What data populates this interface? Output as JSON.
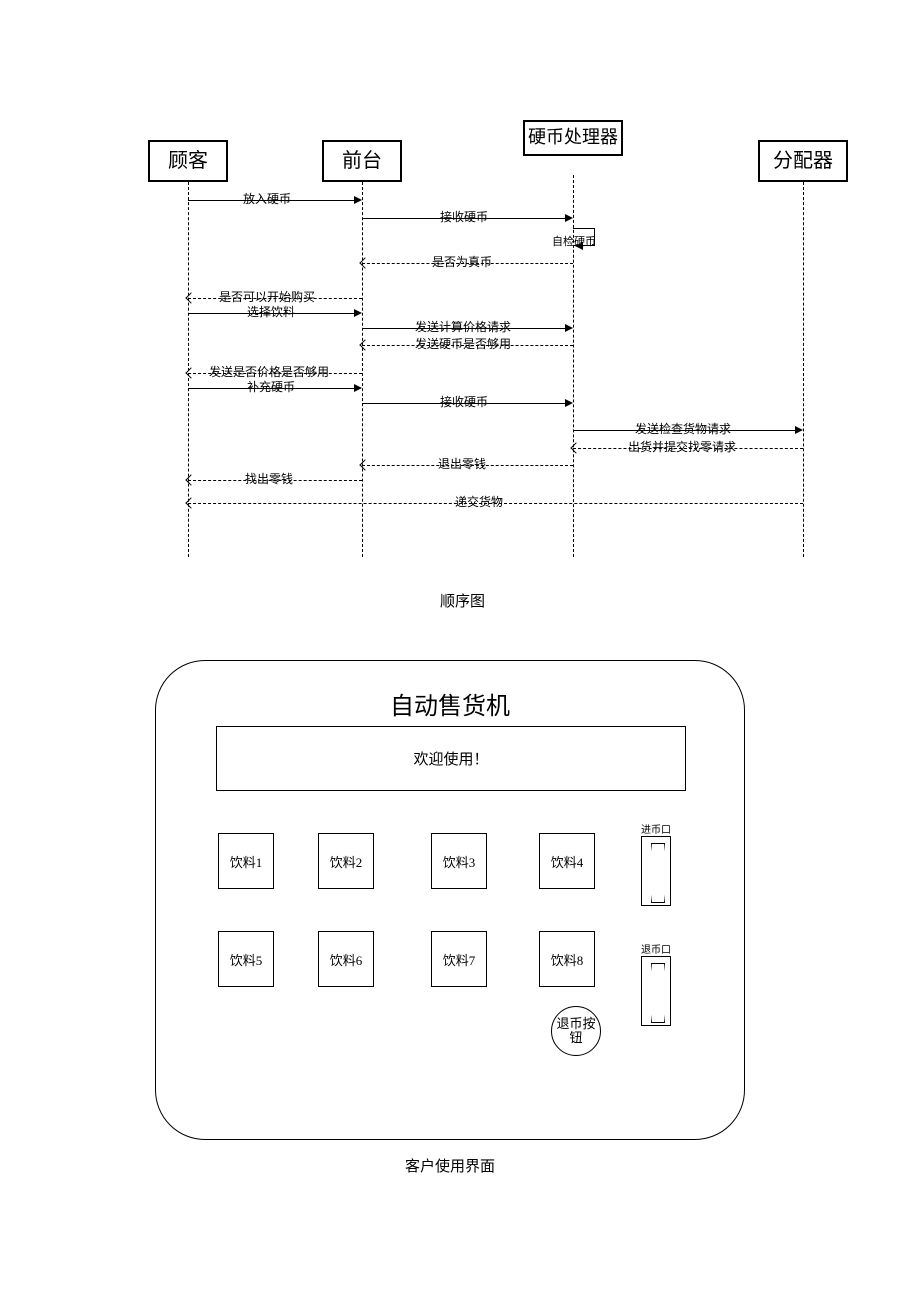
{
  "sequence": {
    "actors": {
      "customer": "顾客",
      "front": "前台",
      "coinHandler": "硬币处理器",
      "dispenser": "分配器"
    },
    "messages": {
      "insertCoin": "放入硬币",
      "recvCoin1": "接收硬币",
      "selfCheck": "自检硬币",
      "isReal": "是否为真币",
      "canBuy": "是否可以开始购买",
      "selectDrink": "选择饮料",
      "sendCalc": "发送计算价格请求",
      "enoughCoin": "发送硬币是否够用",
      "enoughPrice": "发送是否价格是否够用",
      "replenish": "补充硬币",
      "recvCoin2": "接收硬币",
      "checkGoods": "发送检查货物请求",
      "shipChange": "出货并提交找零请求",
      "ejectChange": "退出零钱",
      "giveChange": "找出零钱",
      "deliverGoods": "递交货物"
    },
    "caption": "顺序图"
  },
  "vending": {
    "title": "自动售货机",
    "display": "欢迎使用！",
    "drinks": [
      "饮料1",
      "饮料2",
      "饮料3",
      "饮料4",
      "饮料5",
      "饮料6",
      "饮料7",
      "饮料8"
    ],
    "refund": "退币按钮",
    "coinIn": "进币口",
    "coinOut": "退币口",
    "caption": "客户使用界面"
  }
}
